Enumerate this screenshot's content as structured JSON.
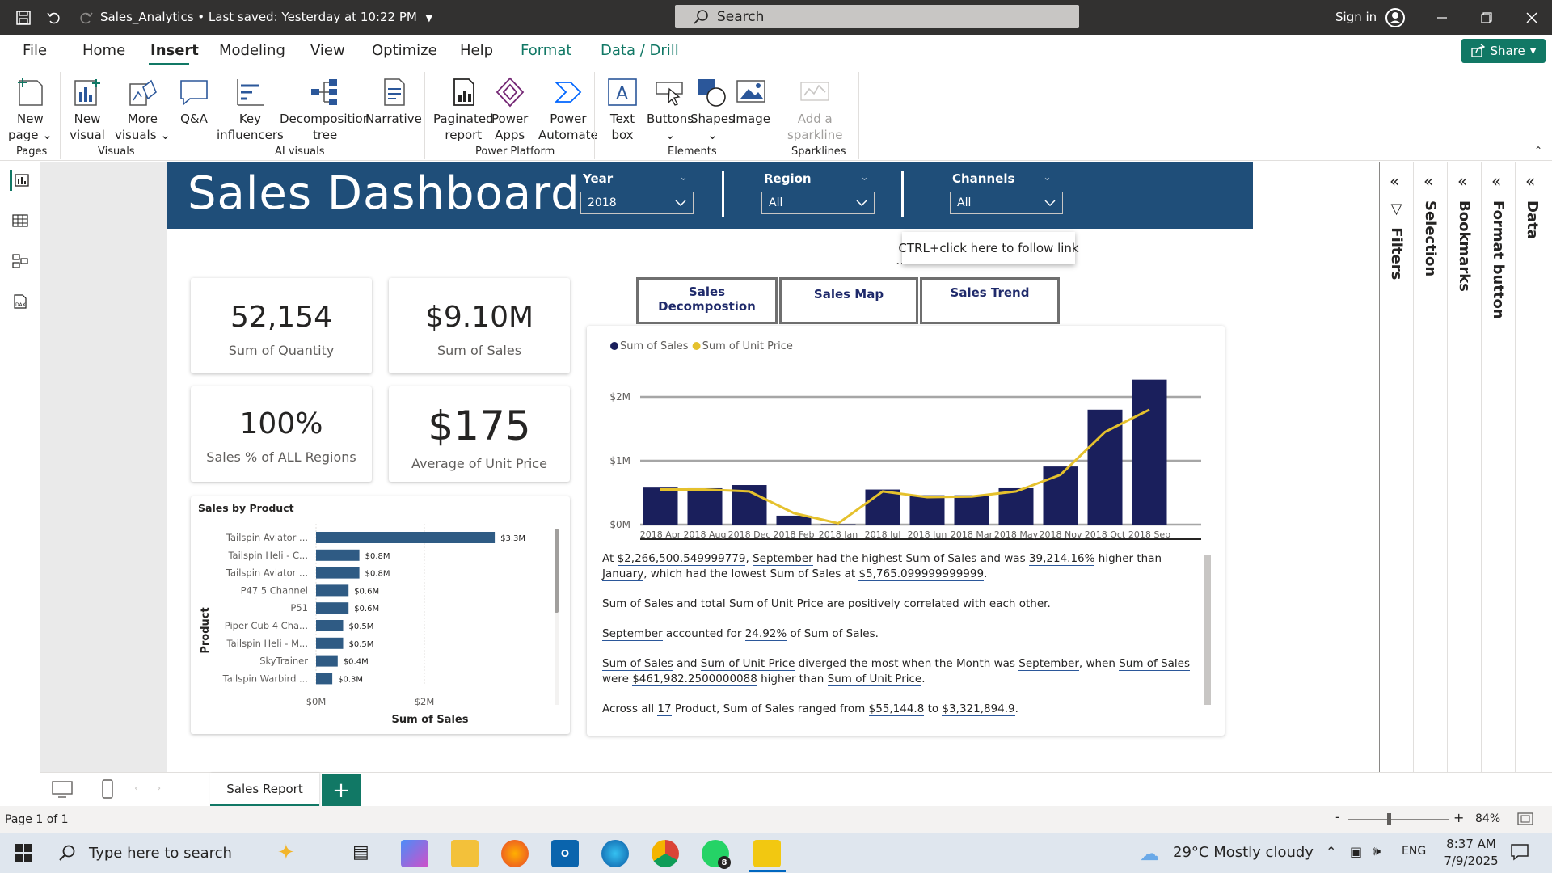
{
  "titlebar": {
    "doc_title": "Sales_Analytics • Last saved: Yesterday at 10:22 PM",
    "search_placeholder": "Search",
    "signin": "Sign in"
  },
  "menu": {
    "items": [
      "File",
      "Home",
      "Insert",
      "Modeling",
      "View",
      "Optimize",
      "Help",
      "Format",
      "Data / Drill"
    ],
    "active": "Insert",
    "share": "Share"
  },
  "ribbon": {
    "buttons": [
      {
        "label": "New\npage ⌄",
        "icon": "new-page-icon"
      },
      {
        "label": "New\nvisual",
        "icon": "new-visual-icon"
      },
      {
        "label": "More\nvisuals ⌄",
        "icon": "more-visuals-icon"
      },
      {
        "label": "Q&A",
        "icon": "qa-icon"
      },
      {
        "label": "Key\ninfluencers",
        "icon": "key-influencers-icon"
      },
      {
        "label": "Decomposition\ntree",
        "icon": "decomposition-tree-icon"
      },
      {
        "label": "Narrative",
        "icon": "narrative-icon"
      },
      {
        "label": "Paginated\nreport",
        "icon": "paginated-report-icon"
      },
      {
        "label": "Power\nApps",
        "icon": "power-apps-icon"
      },
      {
        "label": "Power\nAutomate",
        "icon": "power-automate-icon"
      },
      {
        "label": "Text\nbox",
        "icon": "text-box-icon"
      },
      {
        "label": "Buttons\n⌄",
        "icon": "buttons-icon"
      },
      {
        "label": "Shapes\n⌄",
        "icon": "shapes-icon"
      },
      {
        "label": "Image",
        "icon": "image-icon"
      },
      {
        "label": "Add a\nsparkline",
        "icon": "sparkline-icon"
      }
    ],
    "groups": [
      "Pages",
      "Visuals",
      "AI visuals",
      "Power Platform",
      "Elements",
      "Sparklines"
    ]
  },
  "dashboard": {
    "title": "Sales Dashboard",
    "slicers": [
      {
        "label": "Year",
        "value": "2018"
      },
      {
        "label": "Region",
        "value": "All"
      },
      {
        "label": "Channels",
        "value": "All"
      }
    ],
    "kpis": [
      {
        "value": "52,154",
        "label": "Sum of Quantity"
      },
      {
        "value": "$9.10M",
        "label": "Sum of Sales"
      },
      {
        "value": "100%",
        "label": "Sales % of ALL Regions"
      },
      {
        "value": "$175",
        "label": "Average of Unit Price"
      }
    ],
    "nav_buttons": [
      "Sales Decompostion",
      "Sales Map",
      "Sales Trend"
    ],
    "tooltip": "CTRL+click here to follow link"
  },
  "chart_data": [
    {
      "type": "bar",
      "title": "Sales by Product",
      "orientation": "horizontal",
      "categories": [
        "Tailspin Aviator ...",
        "Tailspin Heli - C...",
        "Tailspin Aviator ...",
        "P47 5 Channel",
        "P51",
        "Piper Cub 4 Cha...",
        "Tailspin Heli - M...",
        "SkyTrainer",
        "Tailspin Warbird ..."
      ],
      "values": [
        3.3,
        0.8,
        0.8,
        0.6,
        0.6,
        0.5,
        0.5,
        0.4,
        0.3
      ],
      "data_labels": [
        "$3.3M",
        "$0.8M",
        "$0.8M",
        "$0.6M",
        "$0.6M",
        "$0.5M",
        "$0.5M",
        "$0.4M",
        "$0.3M"
      ],
      "xlabel": "Sum of Sales",
      "ylabel": "Product",
      "xticks": [
        "$0M",
        "$2M"
      ],
      "xlim": [
        0,
        3.3
      ]
    },
    {
      "type": "bar+line",
      "legend": [
        "Sum of Sales",
        "Sum of Unit Price"
      ],
      "legend_placement": "top-left",
      "categories": [
        "2018 Apr",
        "2018 Aug",
        "2018 Dec",
        "2018 Feb",
        "2018 Jan",
        "2018 Jul",
        "2018 Jun",
        "2018 Mar",
        "2018 May",
        "2018 Nov",
        "2018 Oct",
        "2018 Sep"
      ],
      "series": [
        {
          "name": "Sum of Sales",
          "type": "bar",
          "color": "#1a1f5c",
          "values": [
            0.58,
            0.57,
            0.62,
            0.14,
            0.006,
            0.55,
            0.46,
            0.46,
            0.57,
            0.91,
            1.8,
            2.27
          ]
        },
        {
          "name": "Sum of Unit Price",
          "type": "line",
          "color": "#e5c12d",
          "values": [
            0.55,
            0.55,
            0.52,
            0.18,
            0.02,
            0.52,
            0.43,
            0.44,
            0.52,
            0.78,
            1.45,
            1.8
          ]
        }
      ],
      "yticks": [
        "$0M",
        "$1M",
        "$2M"
      ],
      "ylim": [
        0,
        2.3
      ],
      "grid": true
    }
  ],
  "narrative": [
    [
      {
        "t": "At "
      },
      {
        "t": "$2,266,500.549999779",
        "u": true
      },
      {
        "t": ", "
      },
      {
        "t": "September",
        "u": true
      },
      {
        "t": " had the highest Sum of Sales and was "
      },
      {
        "t": "39,214.16%",
        "u": true
      },
      {
        "t": " higher than "
      },
      {
        "t": "January",
        "u": true
      },
      {
        "t": ", which had the lowest Sum of Sales at "
      },
      {
        "t": "$5,765.099999999999",
        "u": true
      },
      {
        "t": "."
      }
    ],
    [
      {
        "t": "Sum of Sales and total Sum of Unit Price are positively correlated with each other."
      }
    ],
    [
      {
        "t": "September",
        "u": true
      },
      {
        "t": " accounted for "
      },
      {
        "t": "24.92%",
        "u": true
      },
      {
        "t": " of Sum of Sales."
      }
    ],
    [
      {
        "t": "Sum of Sales",
        "u": true
      },
      {
        "t": " and "
      },
      {
        "t": "Sum of Unit Price",
        "u": true
      },
      {
        "t": " diverged the most when the Month was "
      },
      {
        "t": "September",
        "u": true
      },
      {
        "t": ", when "
      },
      {
        "t": "Sum of Sales",
        "u": true
      },
      {
        "t": " were "
      },
      {
        "t": "$461,982.2500000088",
        "u": true
      },
      {
        "t": " higher than "
      },
      {
        "t": "Sum of Unit Price",
        "u": true
      },
      {
        "t": "."
      }
    ],
    [
      {
        "t": "Across all "
      },
      {
        "t": "17",
        "u": true
      },
      {
        "t": " Product, Sum of Sales ranged from "
      },
      {
        "t": "$55,144.8",
        "u": true
      },
      {
        "t": " to "
      },
      {
        "t": "$3,321,894.9",
        "u": true
      },
      {
        "t": "."
      }
    ]
  ],
  "panes": [
    "Filters",
    "Selection",
    "Bookmarks",
    "Format button",
    "Data"
  ],
  "tabs": {
    "page": "Sales Report",
    "add": "+"
  },
  "status": {
    "page": "Page 1 of 1",
    "zoom": "84%"
  },
  "taskbar": {
    "search_placeholder": "Type here to search",
    "weather": "29°C  Mostly cloudy",
    "lang": "ENG",
    "time": "8:37 AM",
    "date": "7/9/2025",
    "whatsapp_badge": "8"
  },
  "colors": {
    "header": "#1f4e79",
    "accent": "#117865",
    "bar_dark": "#1a1f5c",
    "bar_product": "#2f5b84",
    "line": "#e5c12d"
  }
}
